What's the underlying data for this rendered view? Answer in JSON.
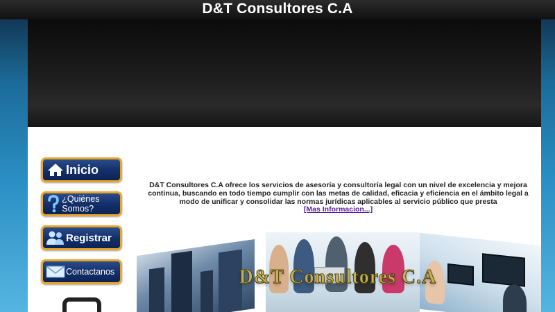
{
  "header": {
    "title": "D&T Consultores C.A"
  },
  "nav": {
    "items": [
      {
        "label": "Inicio",
        "icon": "home-icon"
      },
      {
        "label": "¿Quiénes Somos?",
        "icon": "question-icon"
      },
      {
        "label": "Registrar",
        "icon": "users-icon"
      },
      {
        "label": "Contactanos",
        "icon": "envelope-icon"
      }
    ]
  },
  "intro": {
    "text": "D&T Consultores C.A ofrece los servicios de asesoría y consultoría legal con un nivel de excelencia y mejora continua, buscando en todo tiempo cumplir con las metas de calidad, eficacia y eficiencia en el ámbito legal a modo de unificar y consolidar las normas jurídicas aplicables al servicio público que presta",
    "link": "[Mas Informacion...]"
  },
  "collage": {
    "title": "D&T Consultores C.A"
  },
  "colors": {
    "nav_border": "#e8a72a",
    "nav_bg": "#14306a",
    "link": "#5a1f9c",
    "collage_text": "#c9b04a"
  }
}
